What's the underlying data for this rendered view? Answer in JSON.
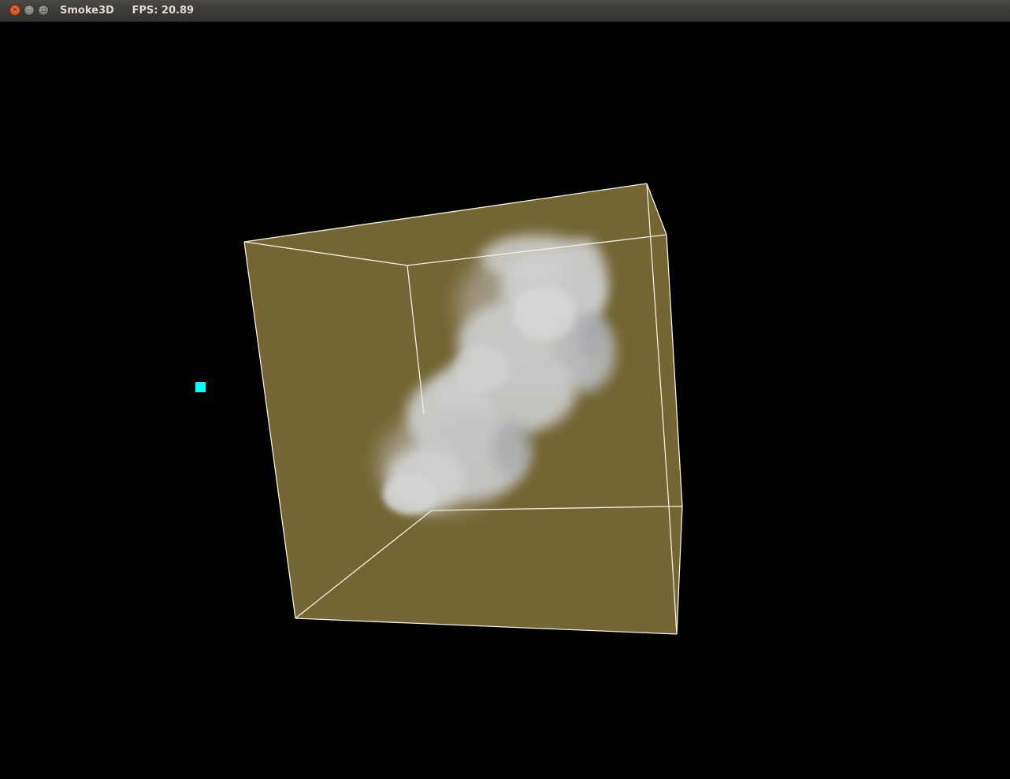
{
  "window": {
    "app_title": "Smoke3D",
    "fps_text": "FPS: 20.89",
    "buttons": {
      "close_icon": "close-icon",
      "minimize_icon": "minimize-icon",
      "maximize_icon": "maximize-icon"
    }
  },
  "scene": {
    "background_color": "#000000",
    "box_face_color": "#736534",
    "box_edge_color": "#f4f0e0",
    "smoke_color": "#cfcfcf",
    "marker_color": "#00ffff"
  }
}
